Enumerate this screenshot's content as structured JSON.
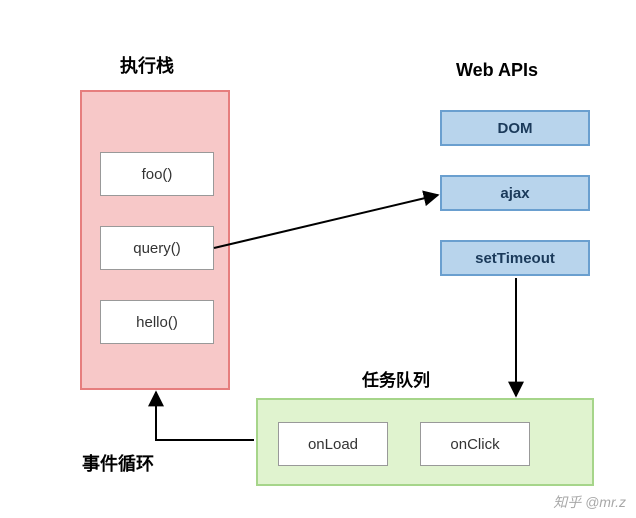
{
  "titles": {
    "stack": "执行栈",
    "webapi": "Web APIs",
    "queue": "任务队列",
    "loop": "事件循环"
  },
  "stack": {
    "items": [
      "foo()",
      "query()",
      "hello()"
    ]
  },
  "webapis": {
    "dom": "DOM",
    "ajax": "ajax",
    "timeout": "setTimeout"
  },
  "queue": {
    "items": [
      "onLoad",
      "onClick"
    ]
  },
  "watermark": "知乎 @mr.z"
}
